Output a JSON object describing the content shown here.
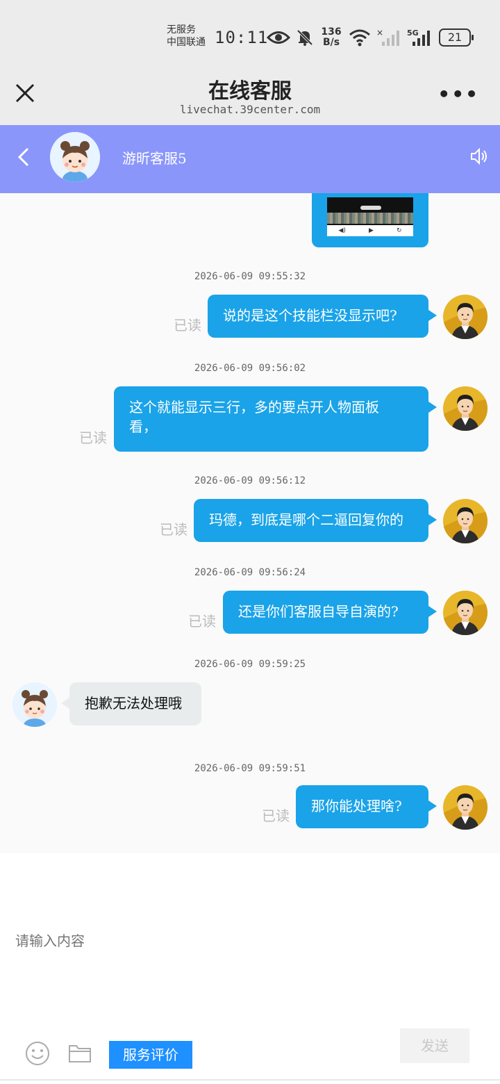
{
  "status_bar": {
    "carrier_line1": "无服务",
    "carrier_line2": "中国联通",
    "time": "10:11",
    "speed_value": "136",
    "speed_unit": "B/s",
    "network": "5G",
    "battery": "21"
  },
  "browser_header": {
    "title": "在线客服",
    "url": "livechat.39center.com"
  },
  "chat_header": {
    "agent_name": "游昕客服5",
    "accent_color": "#8b96fb"
  },
  "messages": [
    {
      "time": "2026-06-09 09:55:32",
      "text": "说的是这个技能栏没显示吧?",
      "read": "已读"
    },
    {
      "time": "2026-06-09 09:56:02",
      "text_line1": "这个就能显示三行，多的要点开人物面板",
      "text_line2": "看，",
      "read": "已读"
    },
    {
      "time": "2026-06-09 09:56:12",
      "text": "玛德，到底是哪个二逼回复你的",
      "read": "已读"
    },
    {
      "time": "2026-06-09 09:56:24",
      "text": "还是你们客服自导自演的?",
      "read": "已读"
    },
    {
      "time": "2026-06-09 09:59:25",
      "text": "抱歉无法处理哦"
    },
    {
      "time": "2026-06-09 09:59:51",
      "text": "那你能处理啥?",
      "read": "已读"
    }
  ],
  "composer": {
    "placeholder": "请输入内容",
    "rate_label": "服务评价",
    "send_label": "发送"
  },
  "colors": {
    "bubble_blue": "#1aa3e8",
    "agent_bubble": "#e8eced",
    "rate_button": "#1e90ff"
  }
}
